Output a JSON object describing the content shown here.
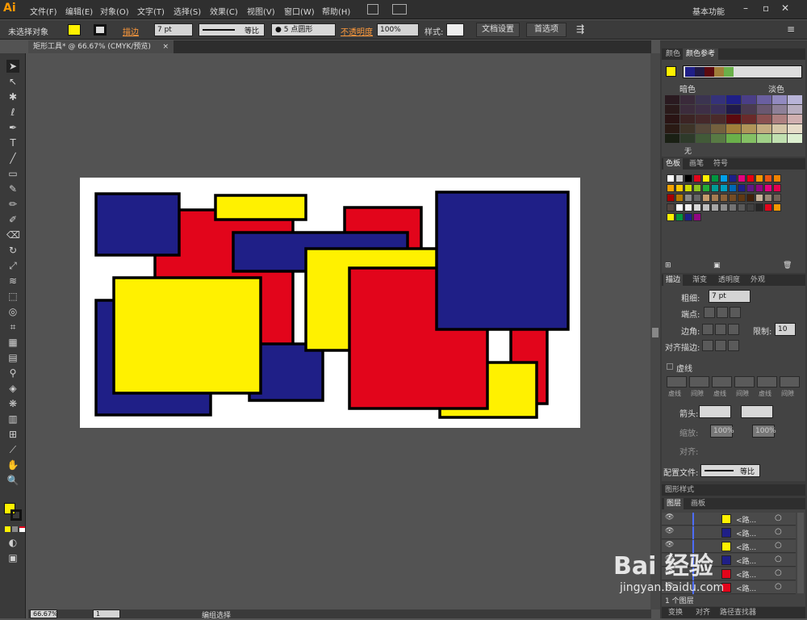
{
  "app": {
    "logo": "Ai"
  },
  "menu": [
    "文件(F)",
    "编辑(E)",
    "对象(O)",
    "文字(T)",
    "选择(S)",
    "效果(C)",
    "视图(V)",
    "窗口(W)",
    "帮助(H)"
  ],
  "workspace": "基本功能",
  "control": {
    "selection": "未选择对象",
    "stroke_label": "描边",
    "stroke_weight": "7 pt",
    "profile": "等比",
    "brush": "5 点圆形",
    "opacity_label": "不透明度",
    "opacity": "100%",
    "style_label": "样式:",
    "doc_setup": "文档设置",
    "prefs": "首选项"
  },
  "document_tab": {
    "title": "矩形工具* @ 66.67% (CMYK/预览)",
    "close": "×"
  },
  "colors": {
    "blue": "#1f1f87",
    "red": "#e2051b",
    "yellow": "#fff100",
    "stroke": "#000000",
    "artboard": "#ffffff"
  },
  "color_guide": {
    "tabs": [
      "颜色",
      "颜色参考"
    ],
    "dark_label": "暗色",
    "light_label": "淡色",
    "none_label": "无"
  },
  "swatches": {
    "tabs": [
      "色板",
      "画笔",
      "符号"
    ]
  },
  "stroke_panel": {
    "tabs": [
      "描边",
      "渐变",
      "透明度",
      "外观"
    ],
    "weight_label": "粗细:",
    "weight_value": "7 pt",
    "cap_label": "端点:",
    "corner_label": "边角:",
    "limit_label": "限制:",
    "limit_value": "10",
    "align_label": "对齐描边:",
    "dashed_label": "虚线",
    "dash_fields": [
      "虚线",
      "间隙",
      "虚线",
      "间隙",
      "虚线",
      "间隙"
    ],
    "arrow_label": "箭头:",
    "scale_label": "缩放:",
    "scale_1": "100%",
    "scale_2": "100%",
    "align2_label": "对齐:",
    "profile_label": "配置文件:",
    "profile_value": "等比"
  },
  "graphic_styles": {
    "tab": "图形样式"
  },
  "layers": {
    "tabs": [
      "图层",
      "画板"
    ],
    "rows": [
      {
        "name": "<路...",
        "color": "#fff100"
      },
      {
        "name": "<路...",
        "color": "#1f1f87"
      },
      {
        "name": "<路...",
        "color": "#fff100"
      },
      {
        "name": "<路...",
        "color": "#1f1f87"
      },
      {
        "name": "<路...",
        "color": "#e2051b"
      },
      {
        "name": "<路...",
        "color": "#e2051b"
      }
    ],
    "footer": "1 个图层"
  },
  "bottom_tabs": [
    "变换",
    "对齐",
    "路径查找器"
  ],
  "status": {
    "zoom": "66.67%",
    "page": "1",
    "mode": "编组选择"
  },
  "watermark": {
    "brand": "Bai 经验",
    "url": "jingyan.baidu.com"
  }
}
